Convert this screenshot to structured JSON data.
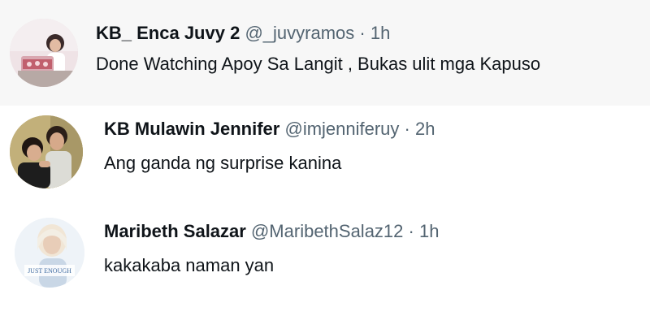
{
  "tweets": [
    {
      "name": "KB_ Enca Juvy 2",
      "handle": "@_juvyramos",
      "separator": "·",
      "time": "1h",
      "text": "Done Watching Apoy Sa Langit , Bukas ulit mga Kapuso",
      "avatar_icon": "profile-photo-avatar"
    },
    {
      "name": "KB Mulawin Jennifer",
      "handle": "@imjenniferuy",
      "separator": "·",
      "time": "2h",
      "text": "Ang ganda ng surprise kanina",
      "avatar_icon": "profile-photo-avatar"
    },
    {
      "name": "Maribeth Salazar",
      "handle": "@MaribethSalaz12",
      "separator": "·",
      "time": "1h",
      "text": "kakakaba naman yan",
      "avatar_icon": "profile-photo-avatar",
      "avatar_caption": "JUST ENOUGH"
    }
  ],
  "colors": {
    "name": "#0f1419",
    "meta": "#536471",
    "highlight_row": "#f7f7f7"
  }
}
